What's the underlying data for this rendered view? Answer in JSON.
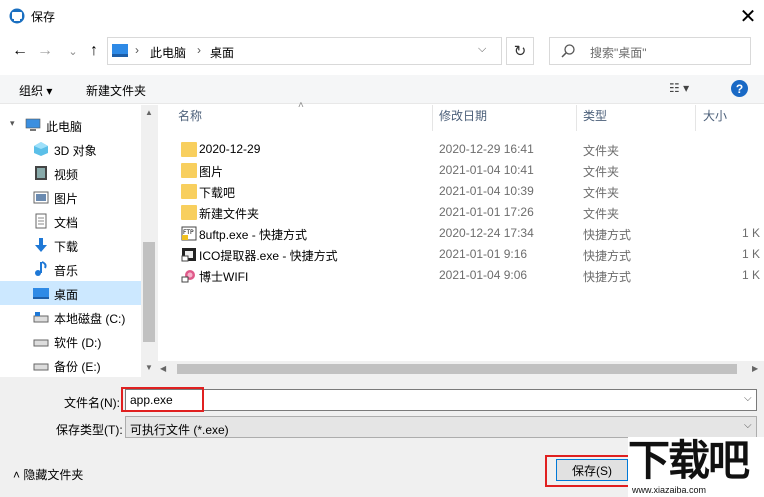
{
  "window": {
    "title": "保存",
    "close_glyph": "✕"
  },
  "nav": {
    "back_glyph": "←",
    "forward_glyph": "→",
    "recent_glyph": "⌄",
    "up_glyph": "↑",
    "breadcrumb": [
      "此电脑",
      "桌面"
    ],
    "sep": "›",
    "dropdown_glyph": "⌵",
    "refresh_glyph": "↻",
    "search_placeholder": "搜索\"桌面\""
  },
  "toolbar": {
    "organize": "组织 ▾",
    "new_folder": "新建文件夹",
    "view": "☷ ▾",
    "help": "?"
  },
  "sidebar": {
    "items": [
      {
        "label": "此电脑",
        "icon": "computer-icon"
      },
      {
        "label": "3D 对象",
        "icon": "3d-objects-icon"
      },
      {
        "label": "视频",
        "icon": "video-icon"
      },
      {
        "label": "图片",
        "icon": "picture-icon"
      },
      {
        "label": "文档",
        "icon": "document-icon"
      },
      {
        "label": "下载",
        "icon": "download-icon"
      },
      {
        "label": "音乐",
        "icon": "music-icon"
      },
      {
        "label": "桌面",
        "icon": "desktop-icon",
        "selected": true
      },
      {
        "label": "本地磁盘 (C:)",
        "icon": "drive-icon"
      },
      {
        "label": "软件 (D:)",
        "icon": "drive-icon"
      },
      {
        "label": "备份 (E:)",
        "icon": "drive-icon"
      }
    ],
    "expand_glyph": "▾"
  },
  "columns": {
    "name": "名称",
    "date": "修改日期",
    "type": "类型",
    "size": "大小",
    "sort_glyph": "˄"
  },
  "files": [
    {
      "name": "2020-12-29",
      "date": "2020-12-29 16:41",
      "type": "文件夹",
      "size": "",
      "icon": "folder-icon"
    },
    {
      "name": "图片",
      "date": "2021-01-04 10:41",
      "type": "文件夹",
      "size": "",
      "icon": "folder-icon"
    },
    {
      "name": "下载吧",
      "date": "2021-01-04 10:39",
      "type": "文件夹",
      "size": "",
      "icon": "folder-icon"
    },
    {
      "name": "新建文件夹",
      "date": "2021-01-01 17:26",
      "type": "文件夹",
      "size": "",
      "icon": "folder-icon"
    },
    {
      "name": "8uftp.exe - 快捷方式",
      "date": "2020-12-24 17:34",
      "type": "快捷方式",
      "size": "1 K",
      "icon": "ftp-shortcut-icon"
    },
    {
      "name": "ICO提取器.exe - 快捷方式",
      "date": "2021-01-01 9:16",
      "type": "快捷方式",
      "size": "1 K",
      "icon": "ico-shortcut-icon"
    },
    {
      "name": "博士WIFI",
      "date": "2021-01-04 9:06",
      "type": "快捷方式",
      "size": "1 K",
      "icon": "wifi-shortcut-icon"
    }
  ],
  "form": {
    "filename_label": "文件名(N):",
    "filename_value": "app.exe",
    "filetype_label": "保存类型(T):",
    "filetype_value": "可执行文件 (*.exe)",
    "dd_glyph": "⌵"
  },
  "footer": {
    "hide_folders": "˄ 隐藏文件夹",
    "save": "保存(S)"
  },
  "watermark": {
    "text": "下载吧",
    "url": "www.xiazaiba.com"
  },
  "colors": {
    "accent": "#0078d7",
    "selection": "#cce8ff",
    "highlight_box": "#e02020",
    "folder": "#f8cf5e"
  }
}
